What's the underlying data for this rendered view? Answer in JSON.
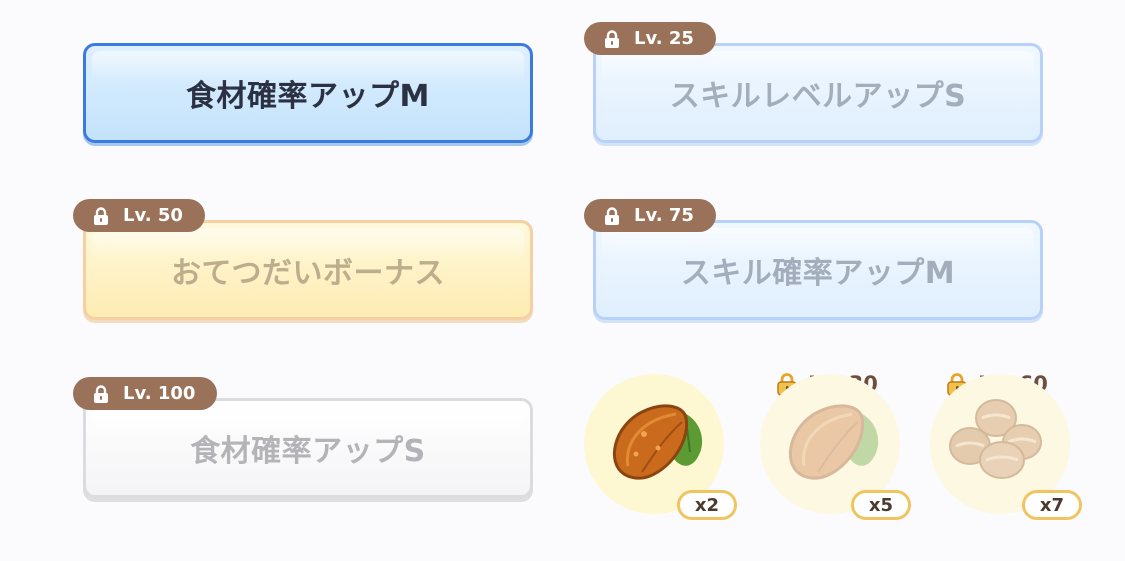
{
  "skills": [
    {
      "name": "食材確率アップM",
      "state": "active",
      "lock_label": ""
    },
    {
      "name": "スキルレベルアップS",
      "state": "locked",
      "lock_label": "Lv. 25"
    },
    {
      "name": "おてつだいボーナス",
      "state": "locked",
      "lock_label": "Lv. 50"
    },
    {
      "name": "スキル確率アップM",
      "state": "locked",
      "lock_label": "Lv. 75"
    },
    {
      "name": "食材確率アップS",
      "state": "locked",
      "lock_label": "Lv. 100"
    }
  ],
  "ingredients": [
    {
      "icon": "cacao-icon",
      "count": "x2",
      "locked": false,
      "lock_label": ""
    },
    {
      "icon": "cacao-icon",
      "count": "x5",
      "locked": true,
      "lock_label": "Lv. 30"
    },
    {
      "icon": "beans-icon",
      "count": "x7",
      "locked": true,
      "lock_label": "Lv. 60"
    }
  ],
  "colors": {
    "active_border": "#3b7be0",
    "lock_badge": "#9a7259",
    "count_border": "#f0c560",
    "text_active": "#2b3142"
  }
}
